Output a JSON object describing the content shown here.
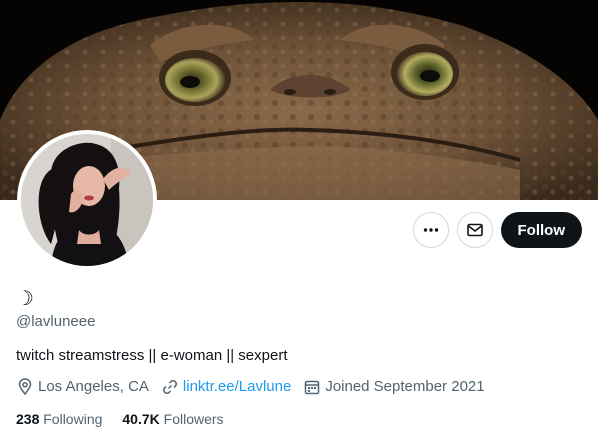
{
  "profile": {
    "display_name": "☽",
    "handle": "@lavluneee",
    "bio": "twitch streamstress || e-woman || sexpert",
    "location": "Los Angeles, CA",
    "website": "linktr.ee/Lavlune",
    "joined": "Joined September 2021",
    "following_count": "238",
    "following_label": "Following",
    "followers_count": "40.7K",
    "followers_label": "Followers"
  },
  "actions": {
    "more_icon": "more-horizontal-icon",
    "message_icon": "envelope-icon",
    "follow_label": "Follow"
  },
  "icons": {
    "location": "location-pin-icon",
    "link": "link-icon",
    "calendar": "calendar-icon"
  },
  "colors": {
    "link": "#1d9bf0",
    "secondary_text": "#536471",
    "follow_button": "#0f1419"
  }
}
